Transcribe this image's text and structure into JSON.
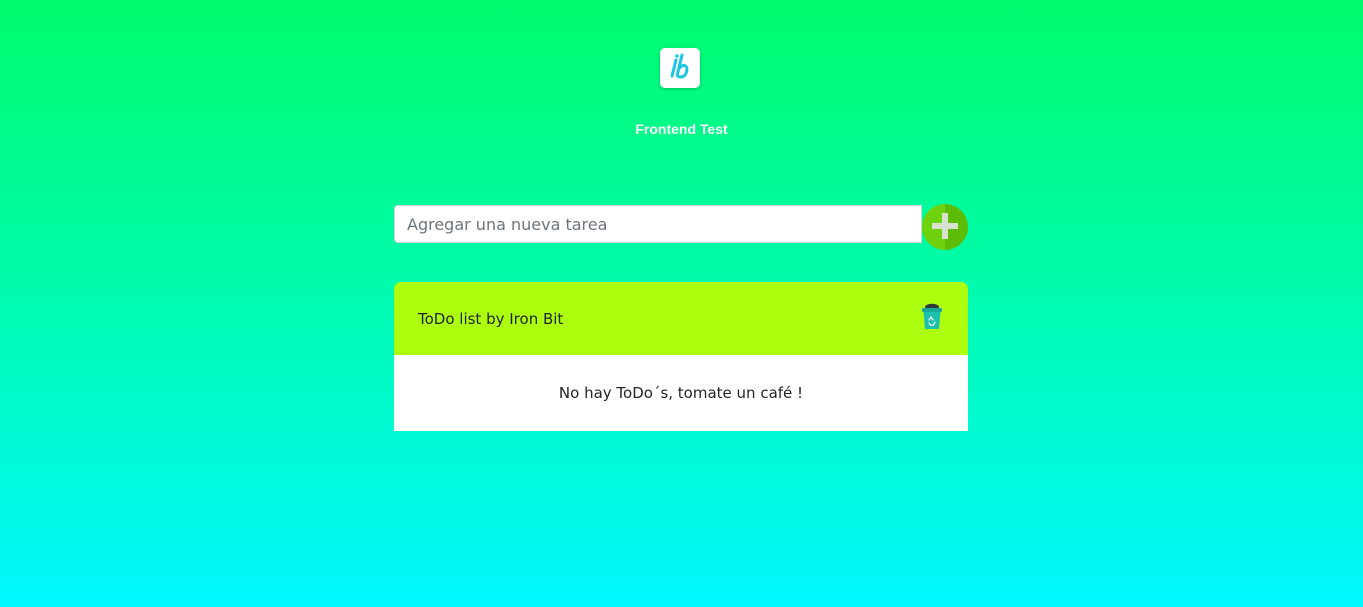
{
  "header": {
    "logo_icon": "ib-logo-icon",
    "title": "Frontend Test"
  },
  "task_form": {
    "input_value": "",
    "placeholder": "Agregar una nueva tarea",
    "add_button_icon": "plus-icon"
  },
  "todo_card": {
    "title": "ToDo list by Iron Bit",
    "clear_button_icon": "recycle-bin-icon",
    "empty_message": "No hay ToDo´s, tomate un café !"
  },
  "colors": {
    "gradient_top": "#00fb6c",
    "gradient_bottom": "#00f9ff",
    "card_header": "#acff0e",
    "add_button": "#6fd20f",
    "logo_accent": "#1fc6e0"
  }
}
